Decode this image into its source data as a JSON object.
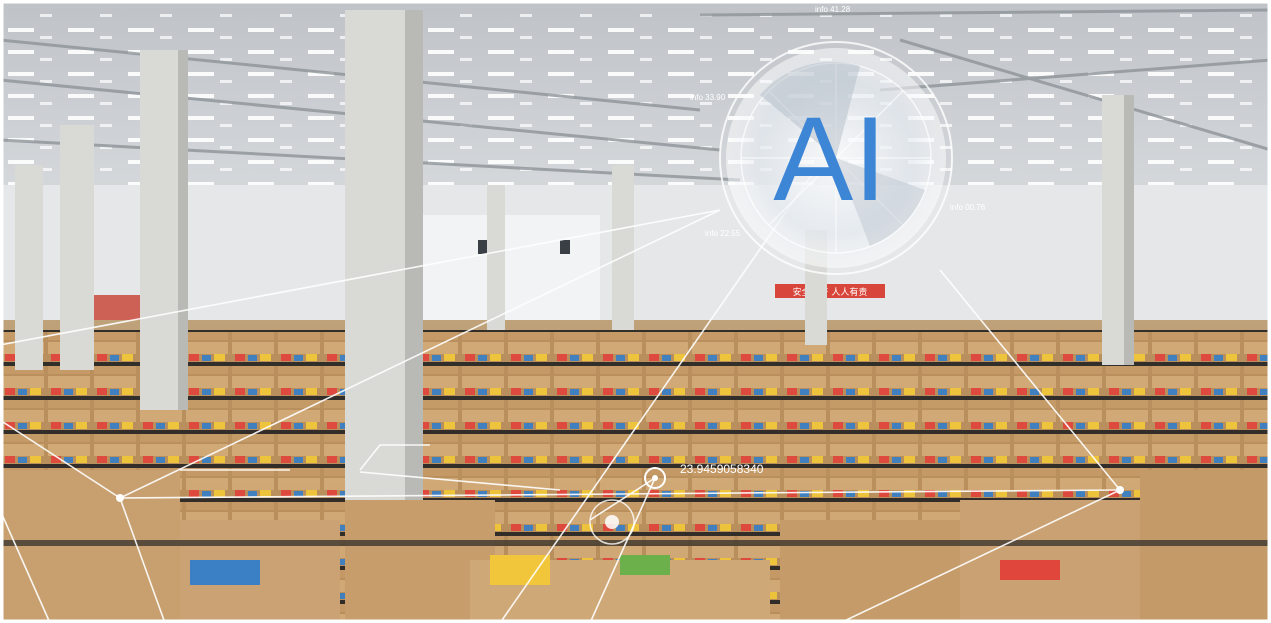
{
  "scene": {
    "description_hidden": "",
    "colors": {
      "ceiling": "#c9ccd0",
      "ceiling_dark": "#9ea3a8",
      "wall": "#e4e6e8",
      "floor_boxes": "#c49a66",
      "box_dark": "#8a6440",
      "rack": "#2c2a28",
      "column": "#d9d9d7",
      "ai_text": "#3d86d6",
      "hud_line": "#ffffff",
      "banner": "#d8453a"
    }
  },
  "overlay": {
    "ai_label": "AI",
    "info_labels": [
      "info 33.90",
      "info 00.76",
      "info 22.55",
      "info 41.28"
    ],
    "coordinate_label": "23.9459058340"
  },
  "banner": {
    "text": "安全生产 人人有责"
  }
}
